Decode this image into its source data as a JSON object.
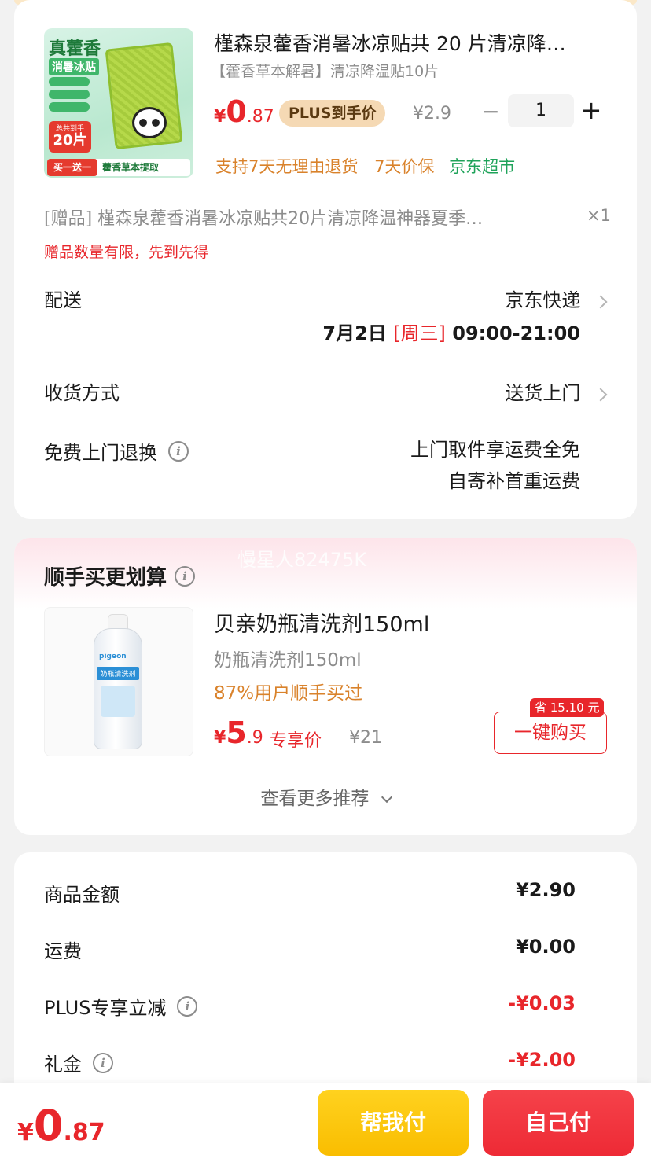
{
  "colors": {
    "price_red": "#e8262b",
    "orange": "#d9822b",
    "green": "#1fa35a",
    "plus_gold": "#f5d9b4",
    "help_pay": "#fdc40a",
    "self_pay": "#f3303a"
  },
  "product": {
    "title": "槿森泉藿香消暑冰凉贴共 20 片清凉降…",
    "subtitle": "【藿香草本解暑】清凉降温贴10片",
    "price_symbol": "¥",
    "price_int": "0",
    "price_dec": ".87",
    "plus_badge": "PLUS到手价",
    "original_price": "¥2.9",
    "qty_minus": "−",
    "quantity": "1",
    "qty_plus": "+",
    "tags": [
      "支持7天无理由退货",
      "7天价保",
      "京东超市"
    ],
    "image_texts": {
      "headline": "真藿香",
      "sub": "消暑冰贴",
      "count_label": "总共到手",
      "count": "20片",
      "bottom_left": "买一送一",
      "bottom_right": "藿香草本提取"
    }
  },
  "gift": {
    "label": "[赠品] 槿森泉藿香消暑冰凉贴共20片清凉降温神器夏季…",
    "qty": "×1",
    "notice": "赠品数量有限，先到先得"
  },
  "delivery": {
    "label": "配送",
    "carrier": "京东快递",
    "date": "7月2日",
    "weekday": "[周三]",
    "time": "09:00-21:00"
  },
  "receive": {
    "label": "收货方式",
    "value": "送货上门"
  },
  "free_return": {
    "label": "免费上门退换",
    "line1": "上门取件享运费全免",
    "line2": "自寄补首重运费"
  },
  "recommend": {
    "title": "顺手买更划算",
    "watermark": "慢星人82475K",
    "item": {
      "name": "贝亲奶瓶清洗剂150ml",
      "desc": "奶瓶清洗剂150ml",
      "stat": "87%用户顺手买过",
      "price_symbol": "¥",
      "price_int": "5",
      "price_dec": ".9",
      "price_label": "专享价",
      "original_price": "¥21",
      "save_badge": "省 15.10 元",
      "buy_button": "一键购买",
      "bottle_brand": "pigeon",
      "bottle_label": "奶瓶清洗剂"
    },
    "more": "查看更多推荐"
  },
  "summary": {
    "rows": [
      {
        "label": "商品金额",
        "value": "¥2.90"
      },
      {
        "label": "运费",
        "value": "¥0.00"
      },
      {
        "label": "PLUS专享立减",
        "value": "-¥0.03"
      },
      {
        "label": "礼金",
        "value": "-¥2.00"
      }
    ]
  },
  "footer": {
    "total_symbol": "¥",
    "total_int": "0",
    "total_dec": ".87",
    "help_pay": "帮我付",
    "self_pay": "自己付"
  }
}
